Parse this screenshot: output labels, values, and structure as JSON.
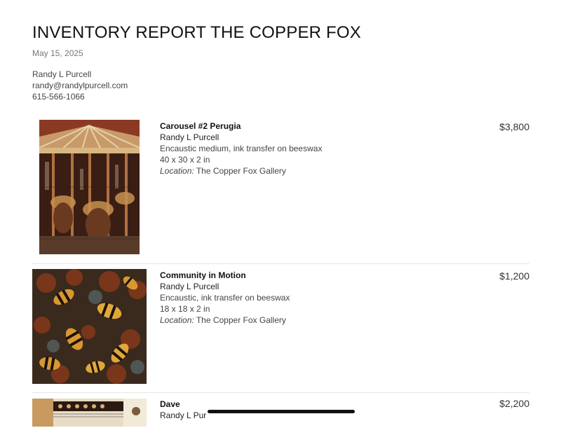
{
  "report": {
    "title": "INVENTORY REPORT THE COPPER FOX",
    "date": "May 15, 2025"
  },
  "contact": {
    "name": "Randy L Purcell",
    "email": "randy@randylpurcell.com",
    "phone": "615-566-1066"
  },
  "items": [
    {
      "title": "Carousel #2 Perugia",
      "artist": "Randy L Purcell",
      "medium": "Encaustic medium, ink transfer on beeswax",
      "dimensions": "40 x 30 x 2 in",
      "location_label": "Location:",
      "location": "The Copper Fox Gallery",
      "price": "$3,800"
    },
    {
      "title": "Community in Motion",
      "artist": "Randy L Purcell",
      "medium": "Encaustic, ink transfer on beeswax",
      "dimensions": "18 x 18 x 2 in",
      "location_label": "Location:",
      "location": "The Copper Fox Gallery",
      "price": "$1,200"
    },
    {
      "title": "Dave",
      "artist": "Randy L Pur",
      "price": "$2,200"
    }
  ],
  "colors": {
    "carousel_palette": [
      "#5a2a1a",
      "#c8a070",
      "#8a4a2a",
      "#e8d0a8"
    ],
    "bees_palette": [
      "#2a1e14",
      "#d89830",
      "#8a3a1a",
      "#5a6a6a"
    ]
  }
}
